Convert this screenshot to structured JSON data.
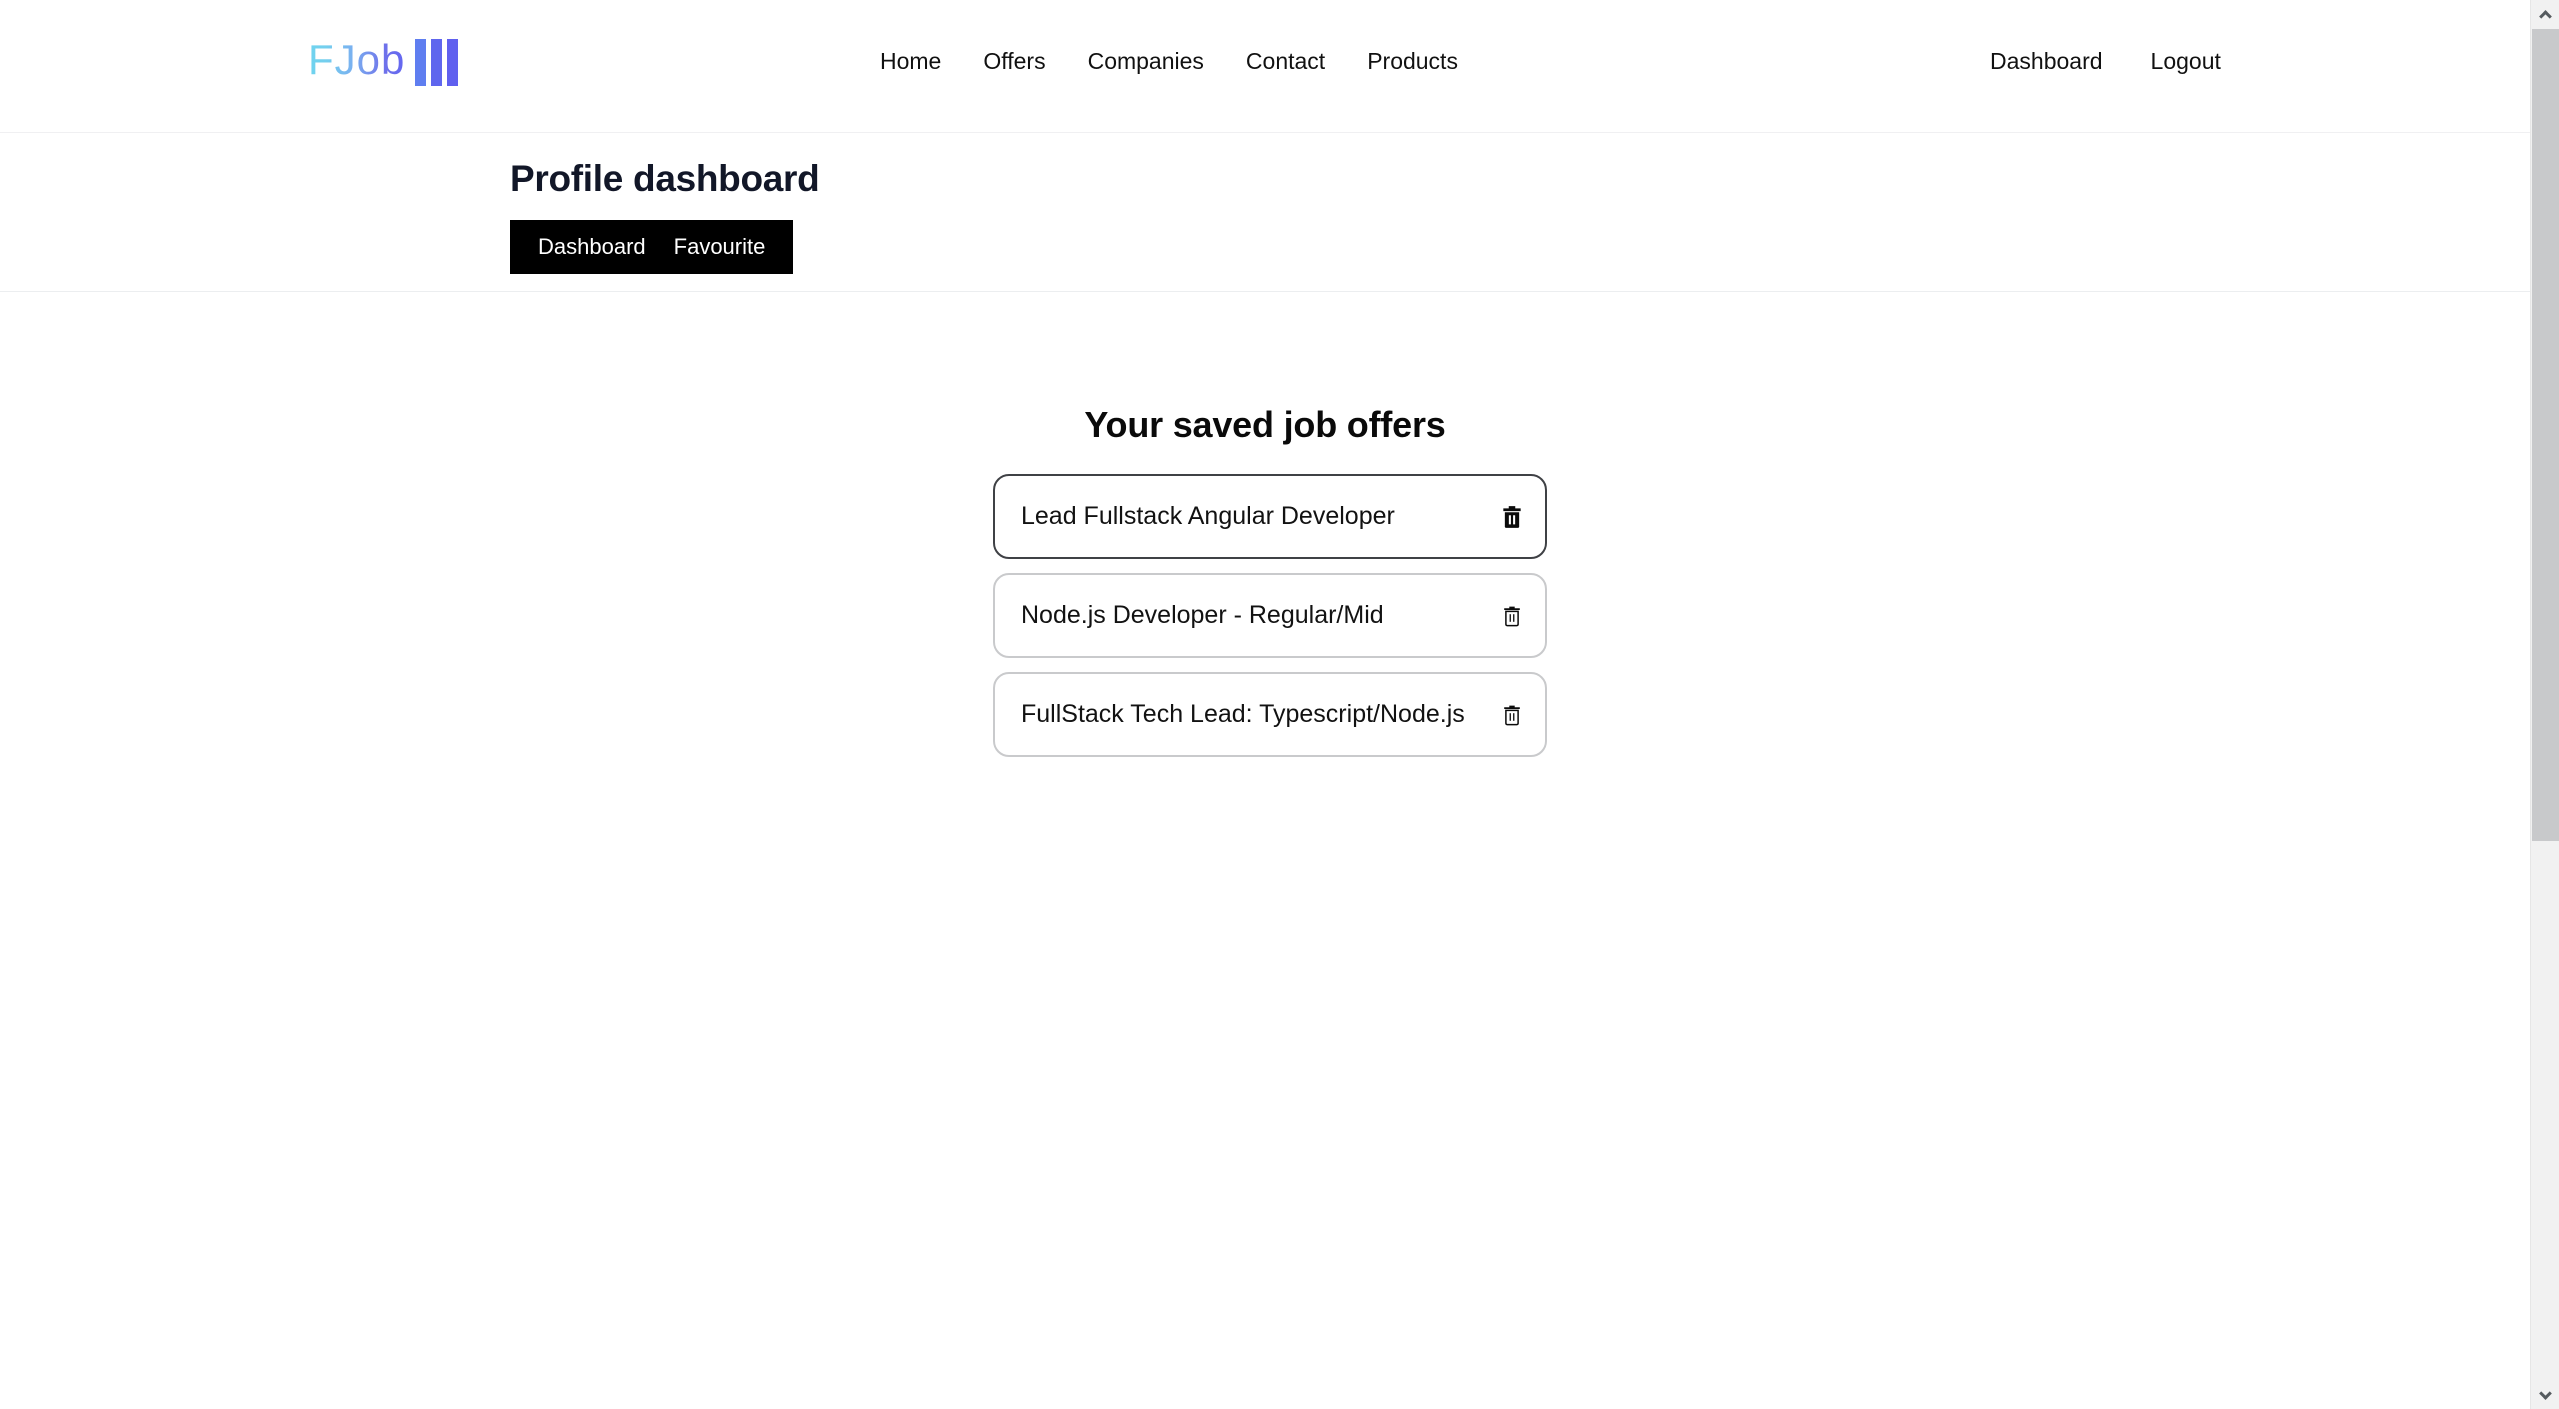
{
  "brand": {
    "name": "FJob",
    "bars_icon": "logo-bars-icon",
    "gradient_from": "#6ed4ef",
    "gradient_to": "#6366f1",
    "bar_color": "#5f66ee"
  },
  "nav": {
    "main_items": [
      {
        "label": "Home"
      },
      {
        "label": "Offers"
      },
      {
        "label": "Companies"
      },
      {
        "label": "Contact"
      },
      {
        "label": "Products"
      }
    ],
    "user_items": [
      {
        "label": "Dashboard"
      },
      {
        "label": "Logout"
      }
    ]
  },
  "subheader": {
    "title": "Profile dashboard",
    "tabs": [
      {
        "label": "Dashboard"
      },
      {
        "label": "Favourite"
      }
    ],
    "tabbar_background": "#000000",
    "tab_text_color": "#ffffff"
  },
  "main": {
    "section_title": "Your saved job offers",
    "offers": [
      {
        "title": "Lead Fullstack Angular Developer",
        "delete_icon": "trash-icon",
        "active": true
      },
      {
        "title": "Node.js Developer - Regular/Mid",
        "delete_icon": "trash-icon",
        "active": false
      },
      {
        "title": "FullStack Tech Lead: Typescript/Node.js",
        "delete_icon": "trash-icon",
        "active": false
      }
    ]
  },
  "scrollbar": {
    "up_icon": "chevron-up-icon",
    "down_icon": "chevron-down-icon",
    "track_color": "#f1f1f1",
    "thumb_color": "#c8c9cb"
  }
}
